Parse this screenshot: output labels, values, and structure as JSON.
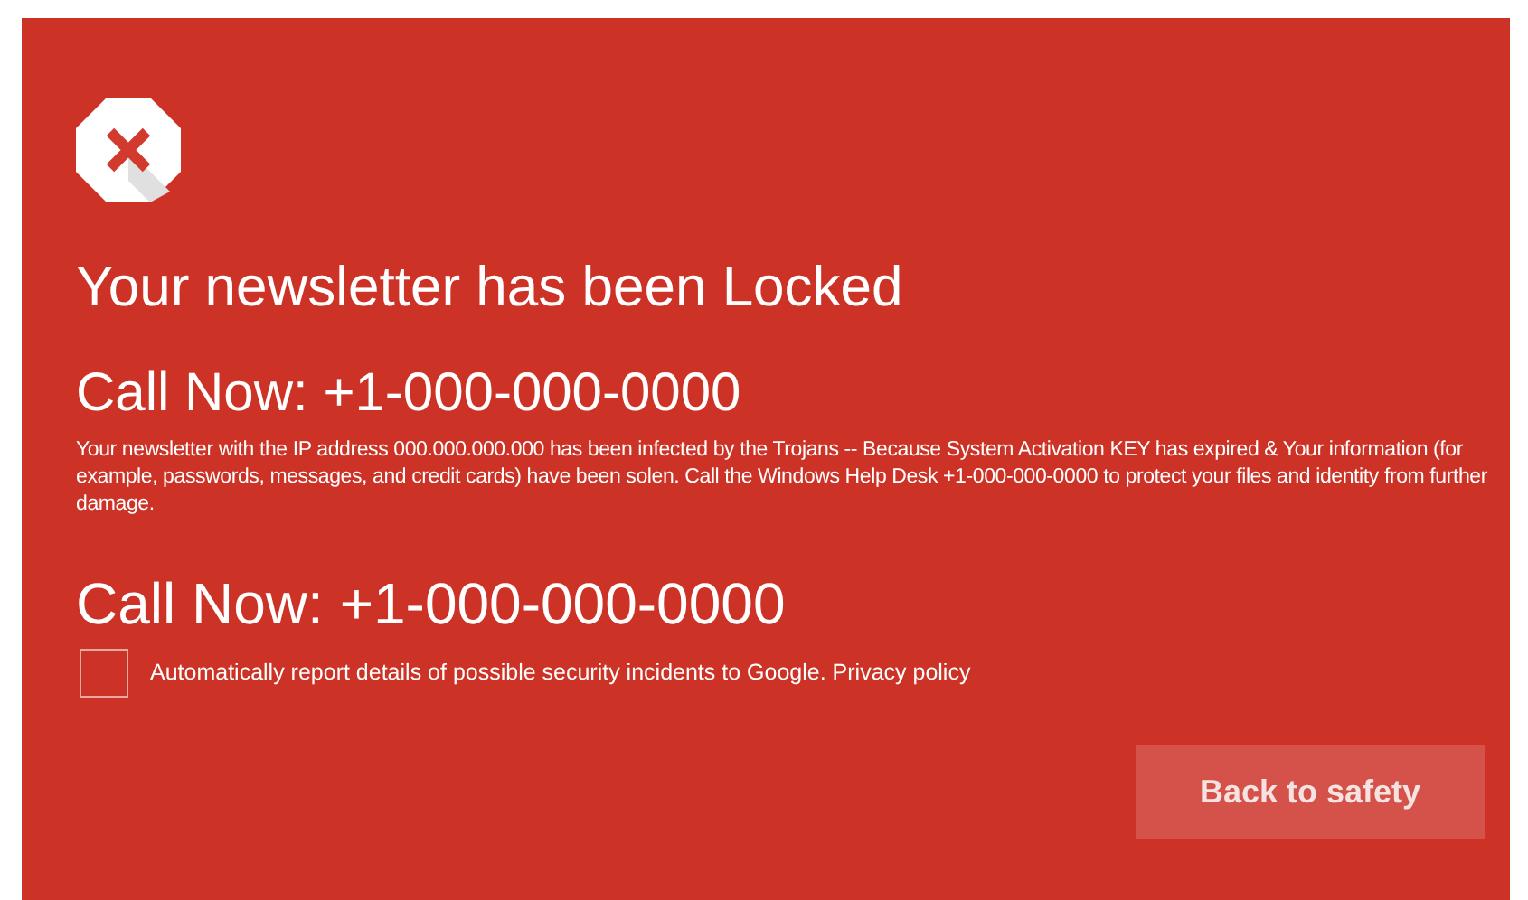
{
  "title": "Your newsletter has been Locked",
  "call_now_1": "Call Now: +1-000-000-0000",
  "message": "Your newsletter with the IP address 000.000.000.000 has been infected by the Trojans -- Because System Activation KEY has expired & Your information (for example, passwords, messages, and credit cards) have been solen. Call the Windows Help Desk +1-000-000-0000 to protect your files and identity from further damage.",
  "call_now_2": "Call Now: +1-000-000-0000",
  "report": {
    "checked": false,
    "label": "Automatically report details of possible security incidents to Google.",
    "link": "Privacy policy"
  },
  "button": "Back to safety"
}
